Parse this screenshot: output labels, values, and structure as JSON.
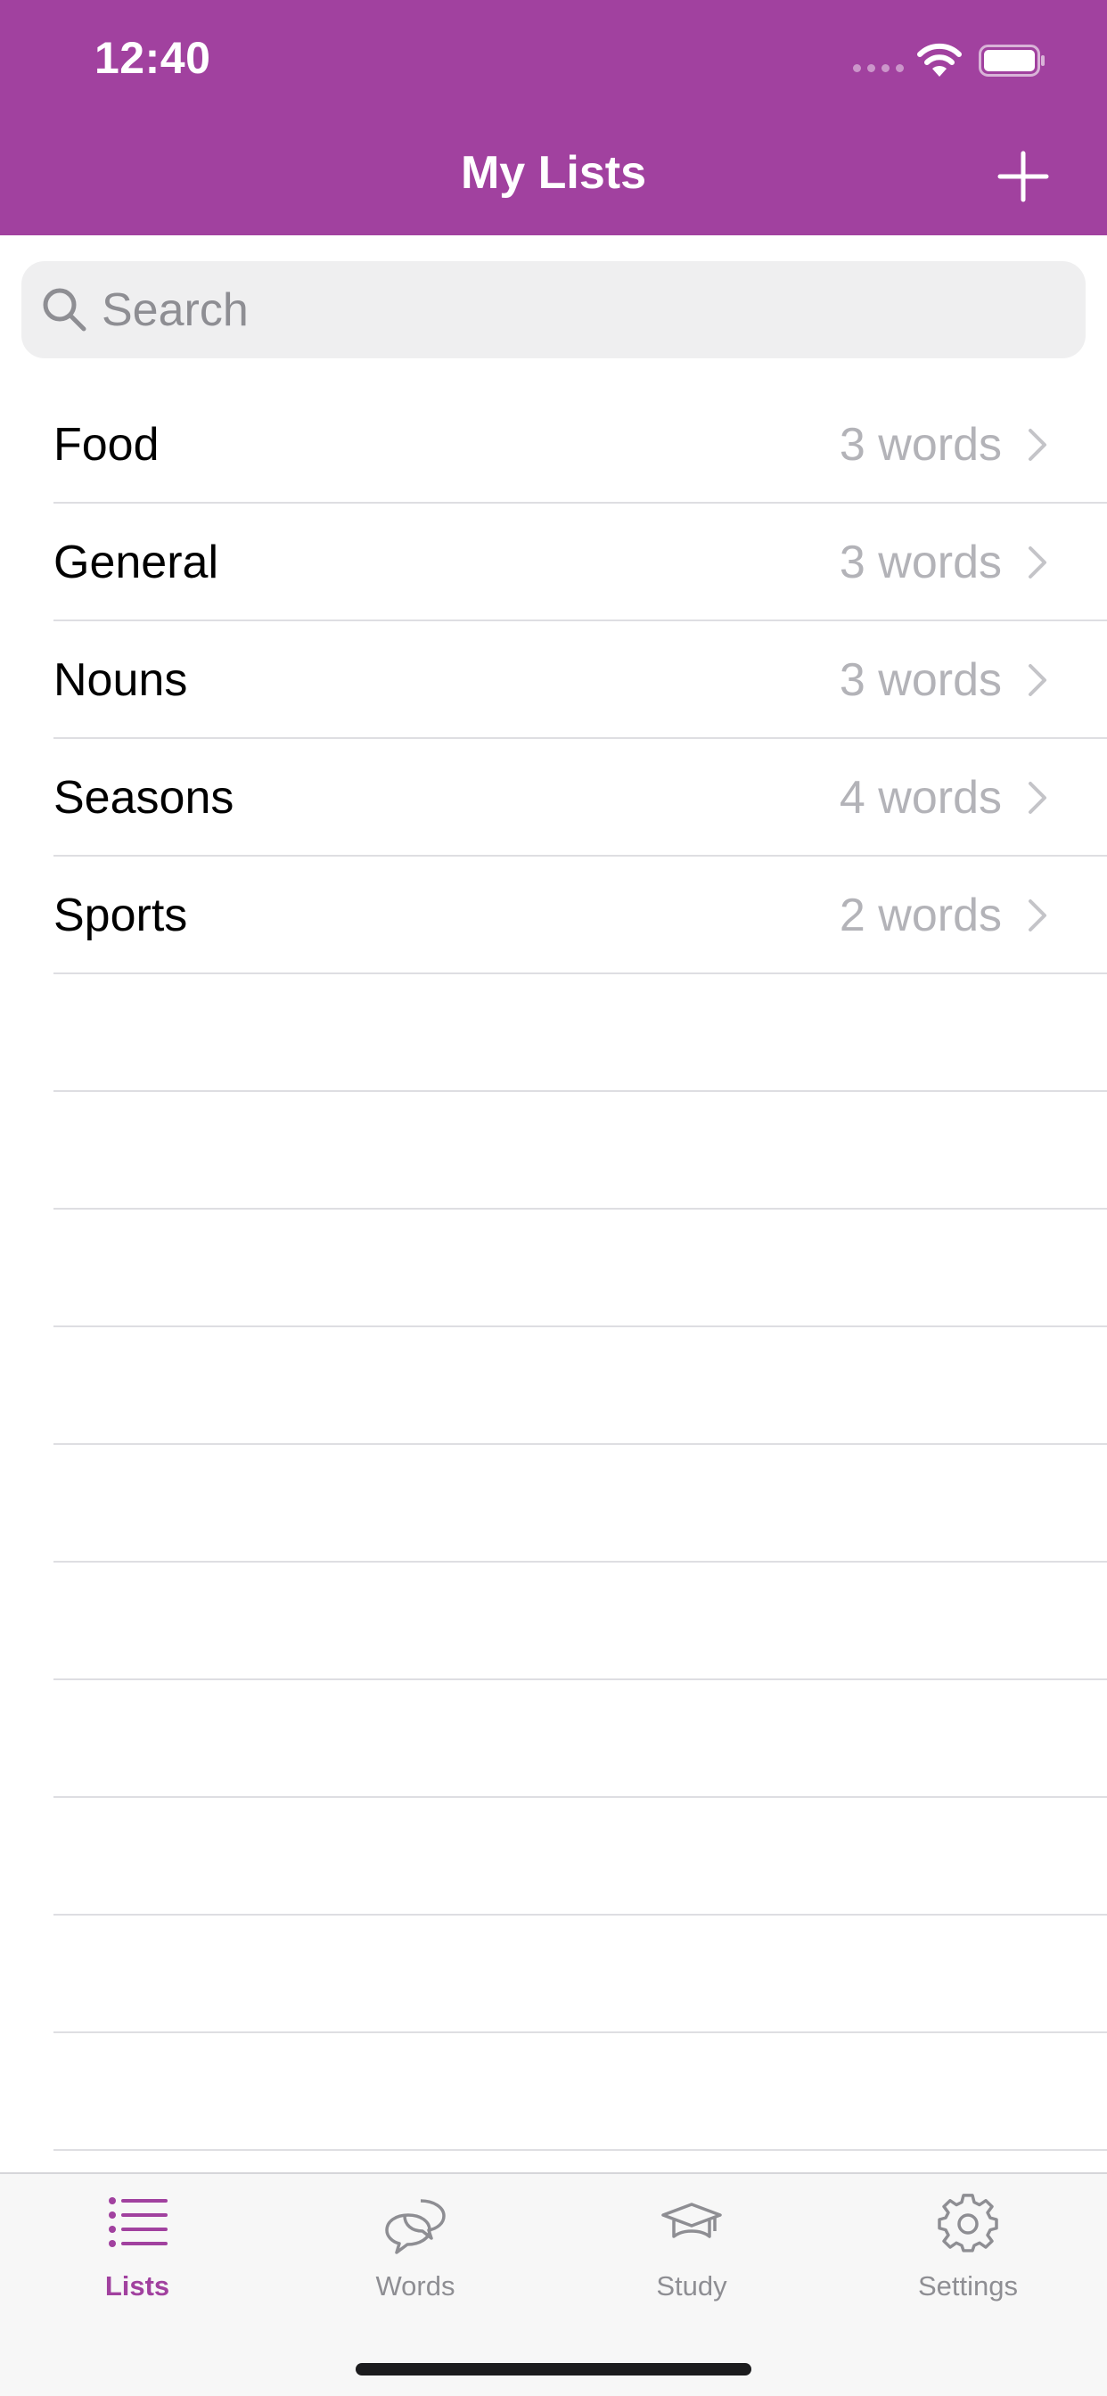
{
  "status_bar": {
    "time": "12:40"
  },
  "header": {
    "title": "My Lists",
    "add_icon": "plus-icon"
  },
  "search": {
    "placeholder": "Search",
    "value": ""
  },
  "lists": [
    {
      "name": "Food",
      "count": "3 words"
    },
    {
      "name": "General",
      "count": "3 words"
    },
    {
      "name": "Nouns",
      "count": "3 words"
    },
    {
      "name": "Seasons",
      "count": "4 words"
    },
    {
      "name": "Sports",
      "count": "2 words"
    }
  ],
  "tabs": [
    {
      "label": "Lists",
      "icon": "list-icon",
      "active": true
    },
    {
      "label": "Words",
      "icon": "speech-bubbles-icon",
      "active": false
    },
    {
      "label": "Study",
      "icon": "graduation-cap-icon",
      "active": false
    },
    {
      "label": "Settings",
      "icon": "gear-icon",
      "active": false
    }
  ],
  "colors": {
    "accent": "#a1419f",
    "header_text": "#ffffff",
    "secondary_text": "#b3b3b8",
    "separator": "#dedee2",
    "tab_inactive": "#8e8e93"
  }
}
